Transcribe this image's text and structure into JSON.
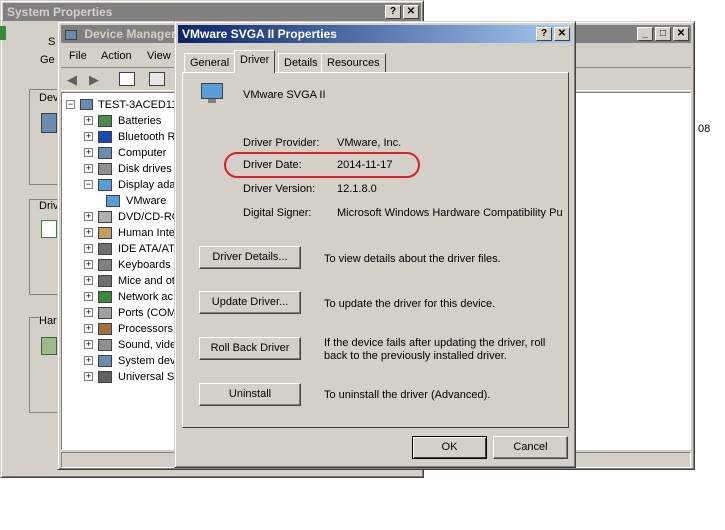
{
  "system_properties": {
    "title": "System Properties",
    "tabs": [
      "S",
      "Ge"
    ],
    "groups": [
      "Dev",
      "Driv",
      "Har"
    ]
  },
  "device_manager": {
    "title": "Device Manager",
    "menu": [
      "File",
      "Action",
      "View"
    ],
    "root": "TEST-3ACED11",
    "items": [
      "Batteries",
      "Bluetooth R",
      "Computer",
      "Disk drives",
      "Display ada",
      "VMware",
      "DVD/CD-RO",
      "Human Inte",
      "IDE ATA/AT",
      "Keyboards",
      "Mice and ot",
      "Network ac",
      "Ports (COM",
      "Processors",
      "Sound, vide",
      "System dev",
      "Universal S"
    ],
    "side_text": "08"
  },
  "props": {
    "title": "VMware SVGA II Properties",
    "tabs": [
      "General",
      "Driver",
      "Details",
      "Resources"
    ],
    "device_name": "VMware SVGA II",
    "provider_label": "Driver Provider:",
    "provider_value": "VMware, Inc.",
    "date_label": "Driver Date:",
    "date_value": "2014-11-17",
    "version_label": "Driver Version:",
    "version_value": "12.1.8.0",
    "signer_label": "Digital Signer:",
    "signer_value": "Microsoft Windows Hardware Compatibility Publ",
    "details_btn": "Driver Details...",
    "details_desc": "To view details about the driver files.",
    "update_btn": "Update Driver...",
    "update_desc": "To update the driver for this device.",
    "rollback_btn": "Roll Back Driver",
    "rollback_desc1": "If the device fails after updating the driver, roll",
    "rollback_desc2": "back to the previously installed driver.",
    "uninstall_btn": "Uninstall",
    "uninstall_desc": "To uninstall the driver (Advanced).",
    "ok_btn": "OK",
    "cancel_btn": "Cancel"
  },
  "colors": {
    "highlight_ring": "#d9202a",
    "titlebar_active": "#0a246a",
    "window_face": "#d4d0c8"
  }
}
